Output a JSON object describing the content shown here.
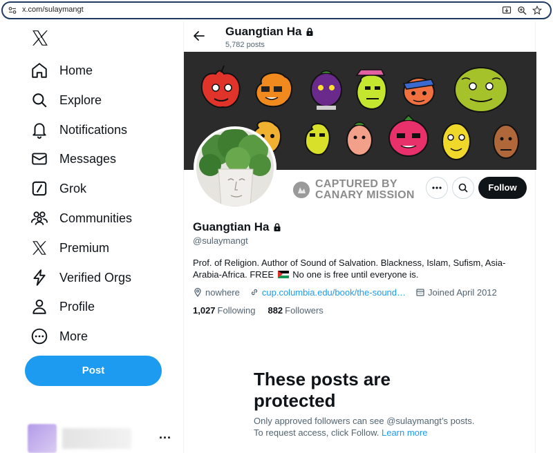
{
  "browser": {
    "url": "x.com/sulaymangt"
  },
  "sidebar": {
    "items": [
      {
        "label": "Home",
        "icon": "home-icon"
      },
      {
        "label": "Explore",
        "icon": "search-icon"
      },
      {
        "label": "Notifications",
        "icon": "bell-icon"
      },
      {
        "label": "Messages",
        "icon": "envelope-icon"
      },
      {
        "label": "Grok",
        "icon": "grok-icon"
      },
      {
        "label": "Communities",
        "icon": "people-icon"
      },
      {
        "label": "Premium",
        "icon": "x-logo-icon"
      },
      {
        "label": "Verified Orgs",
        "icon": "lightning-icon"
      },
      {
        "label": "Profile",
        "icon": "person-icon"
      },
      {
        "label": "More",
        "icon": "more-circle-icon"
      }
    ],
    "post_label": "Post",
    "account_more": "···"
  },
  "header": {
    "name": "Guangtian Ha",
    "posts_count": "5,782 posts"
  },
  "profile": {
    "watermark_line1": "CAPTURED BY",
    "watermark_line2": "CANARY MISSION",
    "follow_label": "Follow",
    "name": "Guangtian Ha",
    "handle": "@sulaymangt",
    "bio_part1": "Prof. of Religion. Author of Sound of Salvation. Blackness, Islam, Sufism, Asia-Arabia-Africa. FREE",
    "bio_part2": "No one is free until everyone is.",
    "location": "nowhere",
    "website": "cup.columbia.edu/book/the-sound…",
    "joined": "Joined April 2012",
    "following_count": "1,027",
    "following_label": "Following",
    "followers_count": "882",
    "followers_label": "Followers"
  },
  "protected": {
    "title": "These posts are protected",
    "text": "Only approved followers can see @sulaymangt’s posts. To request access, click Follow.",
    "link": "Learn more"
  },
  "colors": {
    "accent": "#1d9bf0",
    "text": "#0f1419",
    "secondary": "#536471",
    "follow_bg": "#0f1419",
    "banner_bg": "#2b2b2b"
  }
}
